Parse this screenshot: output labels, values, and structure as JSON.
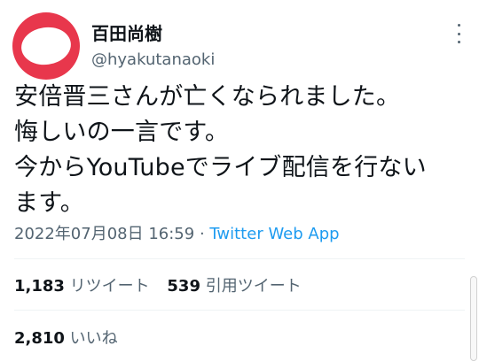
{
  "user": {
    "display_name": "百田尚樹",
    "handle": "@hyakutanaoki"
  },
  "tweet": {
    "text": "安倍晋三さんが亡くなられました。\n悔しいの一言です。\n今からYouTubeでライブ配信を行ない\nます。",
    "timestamp": "2022年07月08日 16:59",
    "separator": " · ",
    "source": "Twitter Web App"
  },
  "stats": {
    "retweets_count": "1,183",
    "retweets_label": "リツイート",
    "quotes_count": "539",
    "quotes_label": "引用ツイート",
    "likes_count": "2,810",
    "likes_label": "いいね"
  },
  "colors": {
    "avatar": "#e8374c",
    "link": "#1d9bf0",
    "secondary_text": "#536471"
  },
  "icons": {
    "more": "more-options-icon"
  }
}
